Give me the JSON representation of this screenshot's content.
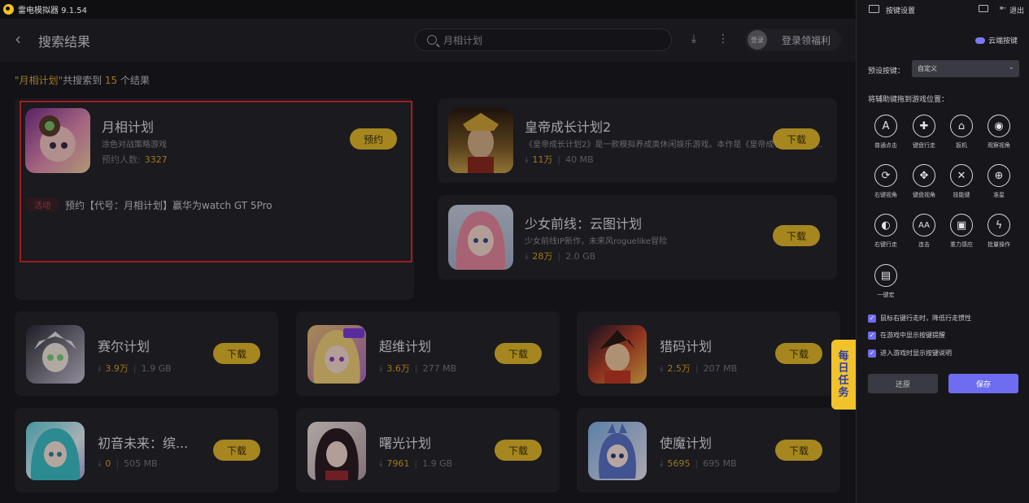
{
  "window": {
    "title": "雷电模拟器 9.1.54"
  },
  "header": {
    "back_icon": "chevron-left-icon",
    "title": "搜索结果",
    "search_value": "月相计划",
    "login_avatar": "登录",
    "login_label": "登录领福利"
  },
  "summary": {
    "prefix": "\"",
    "query": "月相计划",
    "mid": "\"共搜索到",
    "count": "15",
    "suffix": "个结果"
  },
  "featured": {
    "title": "月相计划",
    "desc": "涂色对战策略游戏",
    "reserve_label": "预约人数:",
    "reserve_count": "3327",
    "button": "预约",
    "tag": "活动",
    "event": "预约【代号：月相计划】赢华为watch GT 5Pro"
  },
  "games": [
    {
      "title": "皇帝成长计划2",
      "desc": "《皇帝成长计划2》是一款模拟养成类休闲娱乐游戏。本作是《皇帝成长计划》的...",
      "downloads": "11万",
      "size": "40 MB",
      "button": "下载"
    },
    {
      "title": "少女前线：云图计划",
      "desc": "少女前线IP新作，未来风roguelike冒险",
      "downloads": "28万",
      "size": "2.0 GB",
      "button": "下载"
    },
    {
      "title": "赛尔计划",
      "downloads": "3.9万",
      "size": "1.9 GB",
      "button": "下载"
    },
    {
      "title": "超维计划",
      "downloads": "3.6万",
      "size": "277 MB",
      "button": "下载"
    },
    {
      "title": "猎码计划",
      "downloads": "2.5万",
      "size": "207 MB",
      "button": "下载"
    },
    {
      "title": "初音未来：缤...",
      "downloads": "0",
      "size": "505 MB",
      "button": "下载"
    },
    {
      "title": "曙光计划",
      "downloads": "7961",
      "size": "1.9 GB",
      "button": "下载"
    },
    {
      "title": "使魔计划",
      "downloads": "5695",
      "size": "695 MB",
      "button": "下载"
    }
  ],
  "daily_task": "每日任务",
  "panel": {
    "title": "按键设置",
    "exit": "退出",
    "cloud": "云端按键",
    "preset_label": "预设按键：",
    "preset_value": "自定义",
    "drag_label": "将辅助键拖到游戏位置：",
    "keys": [
      {
        "label": "普通点击",
        "icon": "A"
      },
      {
        "label": "键盘行走",
        "icon": "✚"
      },
      {
        "label": "扳机",
        "icon": "⌂"
      },
      {
        "label": "观察视角",
        "icon": "◉"
      },
      {
        "label": "右键视角",
        "icon": "⟳"
      },
      {
        "label": "键盘视角",
        "icon": "✥"
      },
      {
        "label": "技能键",
        "icon": "✕"
      },
      {
        "label": "准星",
        "icon": "⊕"
      },
      {
        "label": "右键行走",
        "icon": "◐"
      },
      {
        "label": "连击",
        "icon": "AA"
      },
      {
        "label": "重力感应",
        "icon": "▣"
      },
      {
        "label": "批量操作",
        "icon": "ϟ"
      },
      {
        "label": "一键宏",
        "icon": "▤"
      }
    ],
    "checks": [
      "鼠标右键行走时，降低行走惯性",
      "在游戏中显示按键提醒",
      "进入游戏时显示按键说明"
    ],
    "restore": "还原",
    "save": "保存"
  }
}
